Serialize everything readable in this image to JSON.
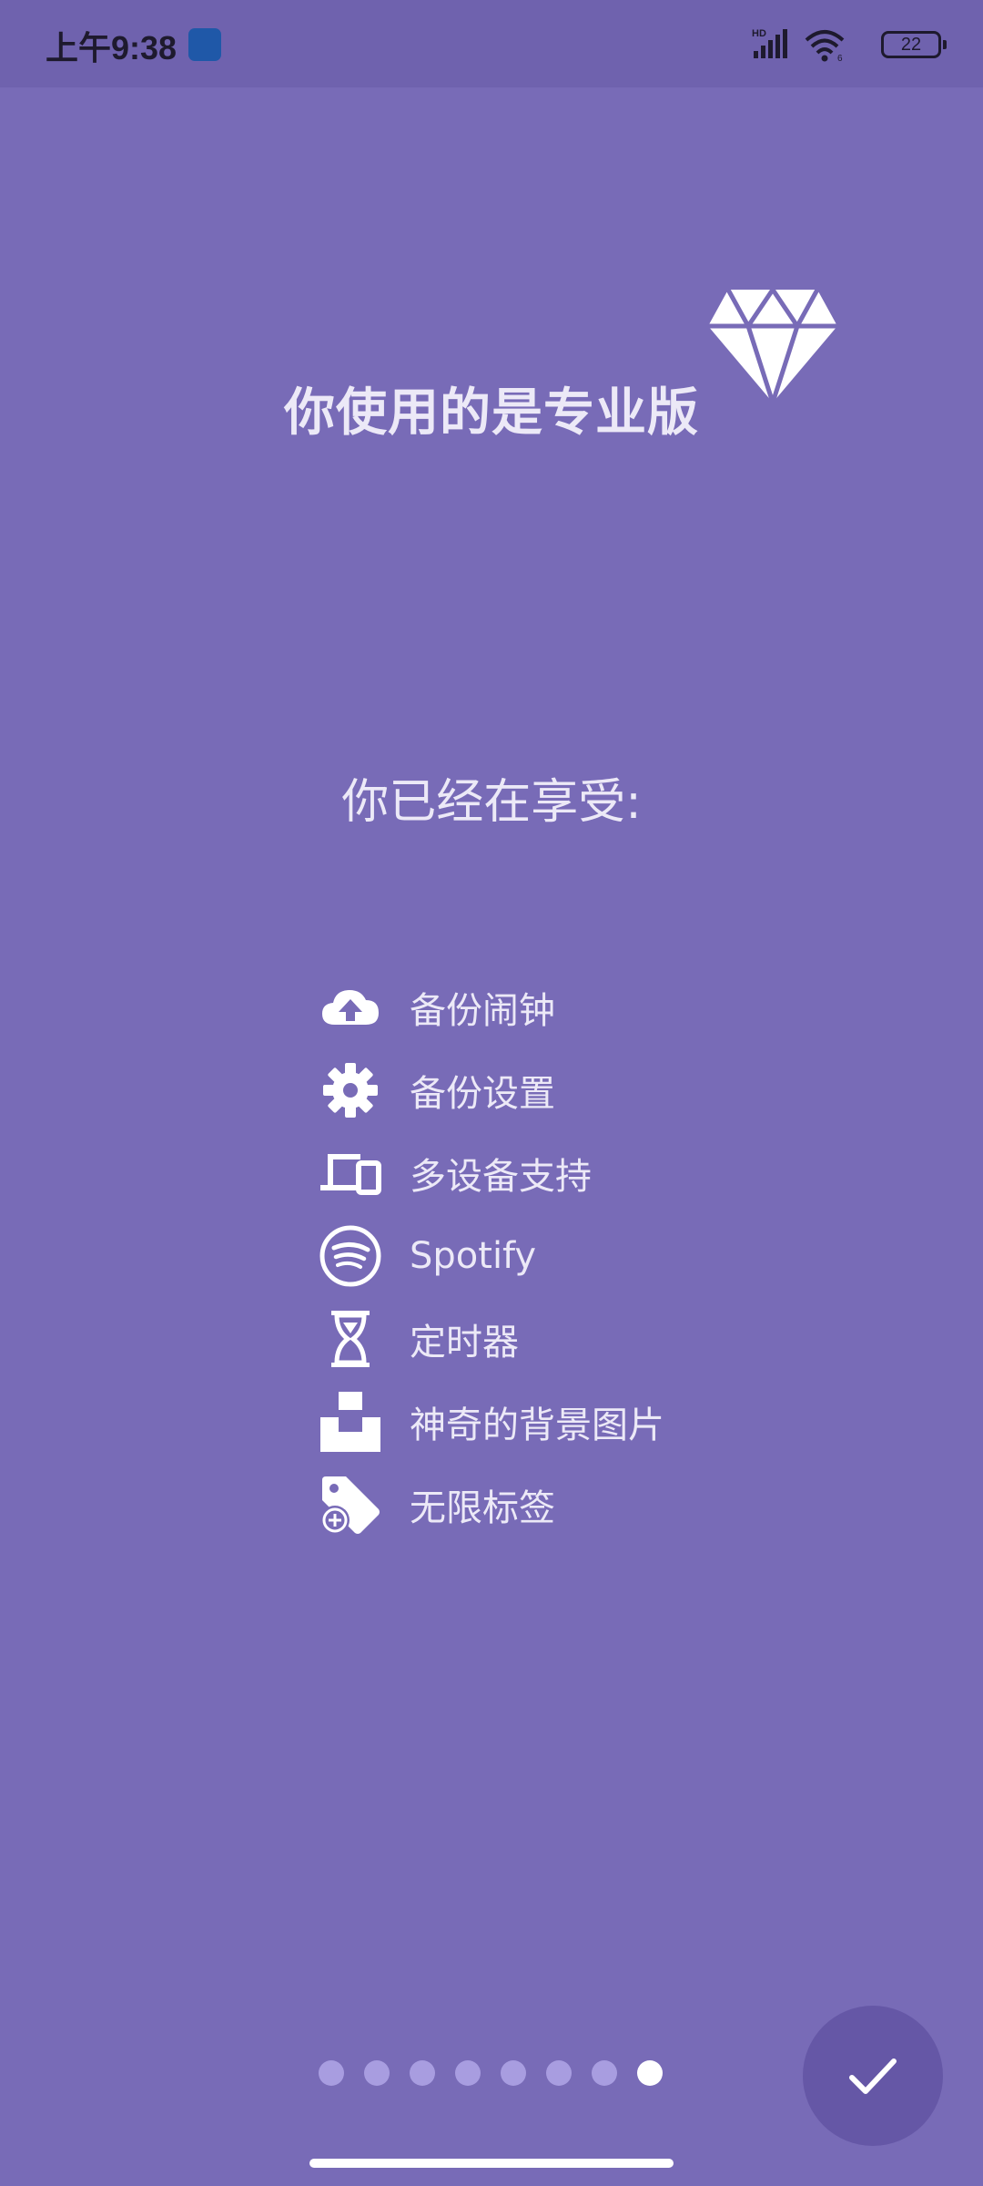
{
  "status_bar": {
    "time": "上午9:38",
    "battery_level": "22",
    "signal_label": "HD",
    "wifi_label": "6"
  },
  "header": {
    "title": "你使用的是专业版",
    "badge_icon": "diamond-icon"
  },
  "subtitle": "你已经在享受:",
  "features": [
    {
      "icon": "cloud-upload-icon",
      "label": "备份闹钟"
    },
    {
      "icon": "gear-icon",
      "label": "备份设置"
    },
    {
      "icon": "devices-icon",
      "label": "多设备支持"
    },
    {
      "icon": "spotify-icon",
      "label": "Spotify"
    },
    {
      "icon": "hourglass-icon",
      "label": "定时器"
    },
    {
      "icon": "unsplash-icon",
      "label": "神奇的背景图片"
    },
    {
      "icon": "tag-add-icon",
      "label": "无限标签"
    }
  ],
  "pager": {
    "total_pages": 8,
    "current_page": 8
  },
  "colors": {
    "background": "#786bb7",
    "status_bar": "#6f62ae",
    "fab": "#6557a6",
    "dot_inactive": "#a89de0",
    "dot_active": "#ffffff"
  }
}
